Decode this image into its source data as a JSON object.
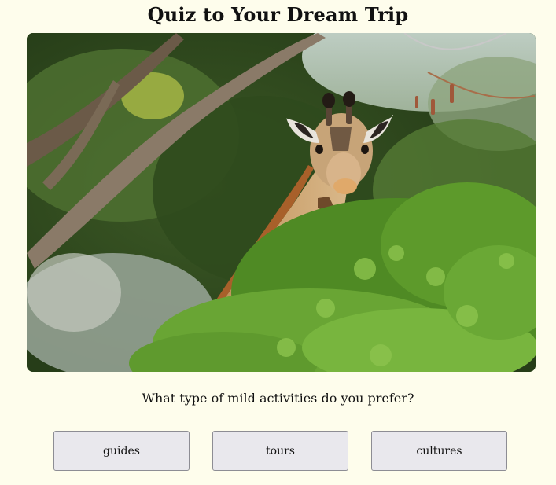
{
  "quiz": {
    "title": "Quiz to Your Dream Trip",
    "hero_image": "giraffe peeking over green bushes",
    "question": "What type of mild activities do you prefer?",
    "answers": [
      {
        "label": "guides"
      },
      {
        "label": "tours"
      },
      {
        "label": "cultures"
      }
    ]
  },
  "colors": {
    "background": "#fefdec",
    "button_bg": "#e9e8ed",
    "button_border": "#8d8d94"
  }
}
